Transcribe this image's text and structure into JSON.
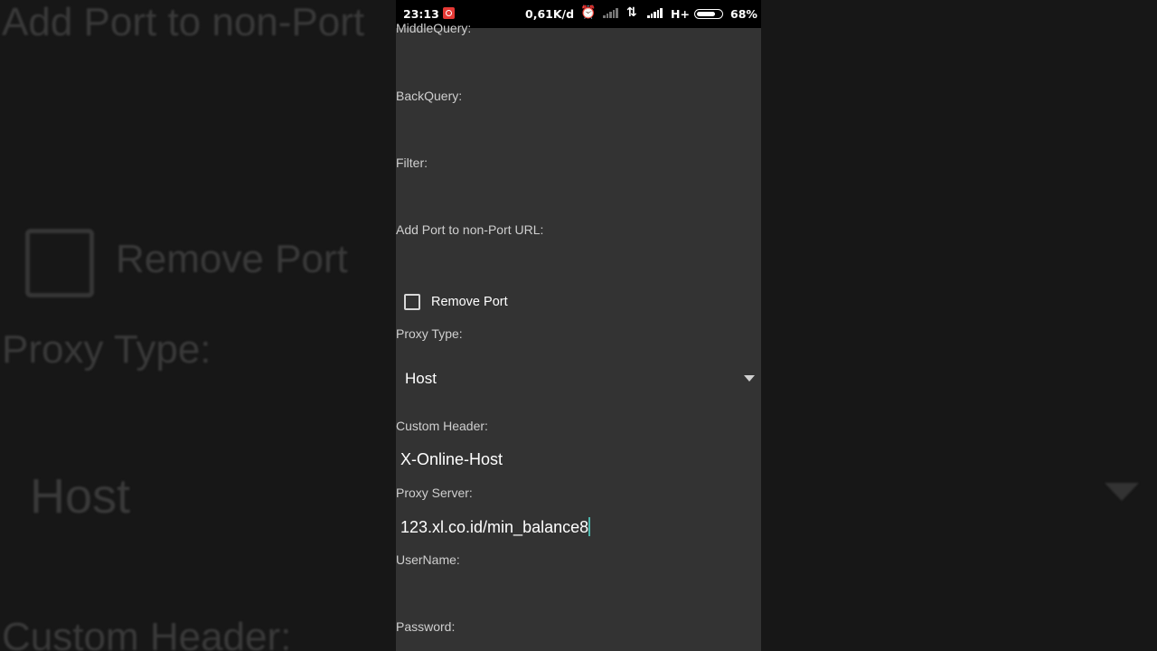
{
  "background": {
    "zoom_title": "Add Port to non-Port",
    "zoom_remove_port": "Remove Port",
    "zoom_proxy_type": "Proxy Type:",
    "zoom_host": "Host",
    "zoom_custom_header": "Custom Header:"
  },
  "statusbar": {
    "time": "23:13",
    "speed": "0,61K/d",
    "network": "H+",
    "battery": "68%",
    "battery_level_pct": 68
  },
  "form": {
    "middle_query_label": "MiddleQuery:",
    "back_query_label": "BackQuery:",
    "filter_label": "Filter:",
    "add_port_label": "Add Port to non-Port URL:",
    "remove_port_label": "Remove Port",
    "remove_port_checked": false,
    "proxy_type_label": "Proxy Type:",
    "proxy_type_value": "Host",
    "custom_header_label": "Custom Header:",
    "custom_header_value": "X-Online-Host",
    "proxy_server_label": "Proxy Server:",
    "proxy_server_value": "123.xl.co.id/min_balance8",
    "username_label": "UserName:",
    "password_label": "Password:"
  },
  "colors": {
    "screen_bg": "#333333",
    "accent_cursor": "#4db6ac",
    "record_icon": "#e53935"
  }
}
